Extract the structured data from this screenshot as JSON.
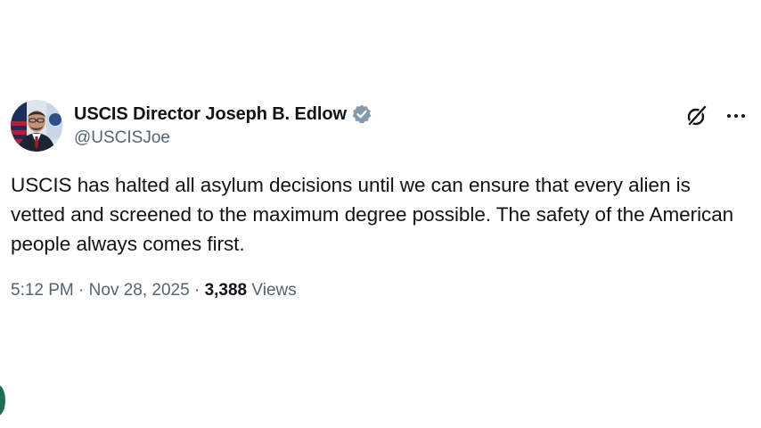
{
  "tweet": {
    "author": {
      "display_name": "USCIS Director Joseph B. Edlow",
      "handle": "@USCISJoe",
      "verified_icon": "verified-badge-icon"
    },
    "actions": {
      "grok_icon": "grok-icon",
      "more_icon": "more-options-icon",
      "more_label": "···"
    },
    "text": "USCIS has halted all asylum decisions until we can ensure that every alien is vetted and screened to the maximum degree possible. The safety of the American people always comes first.",
    "meta": {
      "time": "5:12 PM",
      "separator": " · ",
      "date": "Nov 28, 2025",
      "views_count": "3,388",
      "views_label": " Views"
    }
  },
  "colors": {
    "text_primary": "#0f1419",
    "text_secondary": "#536471",
    "verified_badge": "#829aab",
    "background": "#ffffff"
  }
}
